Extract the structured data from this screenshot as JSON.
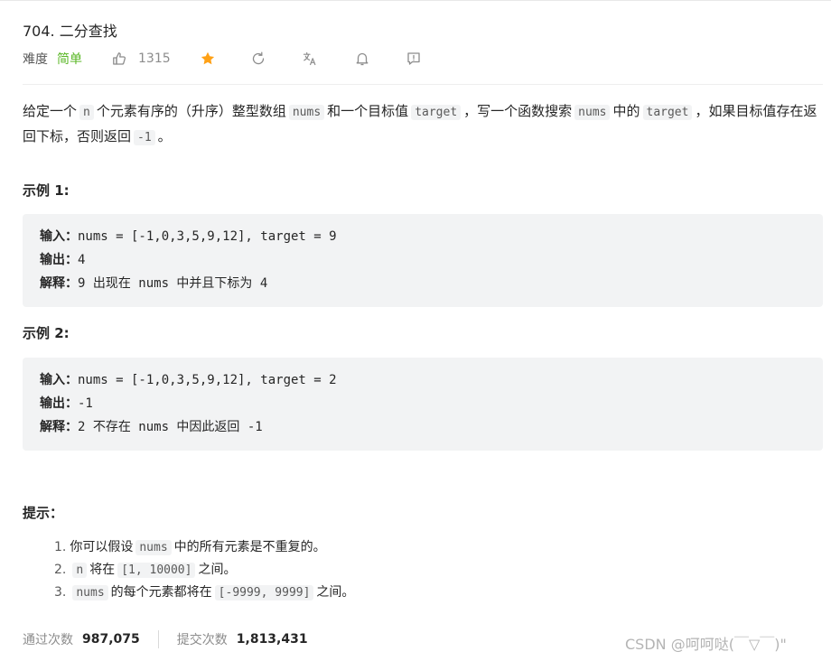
{
  "problem": {
    "title": "704. 二分查找",
    "difficulty_label": "难度",
    "difficulty": "简单",
    "likes": "1315"
  },
  "description": {
    "p1": "给定一个",
    "c1": "n",
    "p2": "个元素有序的（升序）整型数组",
    "c2": "nums",
    "p3": "和一个目标值",
    "c3": "target",
    "p4": "，写一个函数搜索",
    "c4": "nums",
    "p5": "中的",
    "c5": "target",
    "p6": "，如果目标值存在返回下标，否则返回",
    "c6": "-1",
    "p7": "。"
  },
  "examples": [
    {
      "heading": "示例 1:",
      "input_label": "输入：",
      "input": "nums = [-1,0,3,5,9,12], target = 9",
      "output_label": "输出：",
      "output": "4",
      "explain_label": "解释：",
      "explain": "9 出现在 nums 中并且下标为 4"
    },
    {
      "heading": "示例 2:",
      "input_label": "输入：",
      "input": "nums = [-1,0,3,5,9,12], target = 2",
      "output_label": "输出：",
      "output": "-1",
      "explain_label": "解释：",
      "explain": "2 不存在 nums 中因此返回 -1"
    }
  ],
  "tips": {
    "heading": "提示：",
    "items": [
      {
        "num": "1.",
        "a": "你可以假设",
        "code": "nums",
        "b": "中的所有元素是不重复的。"
      },
      {
        "num": "2.",
        "code_pre": "n",
        "a": "将在",
        "code": "[1, 10000]",
        "b": "之间。"
      },
      {
        "num": "3.",
        "code_pre": "nums",
        "a": "的每个元素都将在",
        "code": "[-9999, 9999]",
        "b": "之间。"
      }
    ]
  },
  "stats": {
    "accepted_label": "通过次数",
    "accepted": "987,075",
    "submitted_label": "提交次数",
    "submitted": "1,813,431"
  },
  "watermark": "CSDN @呵呵哒(￣▽￣)\"",
  "colors": {
    "easy": "#5ab726",
    "star": "#ffa116",
    "code_bg": "#f2f3f4"
  },
  "icons": [
    "thumbs-up-icon",
    "star-icon",
    "refresh-icon",
    "translate-icon",
    "bell-icon",
    "feedback-icon"
  ]
}
